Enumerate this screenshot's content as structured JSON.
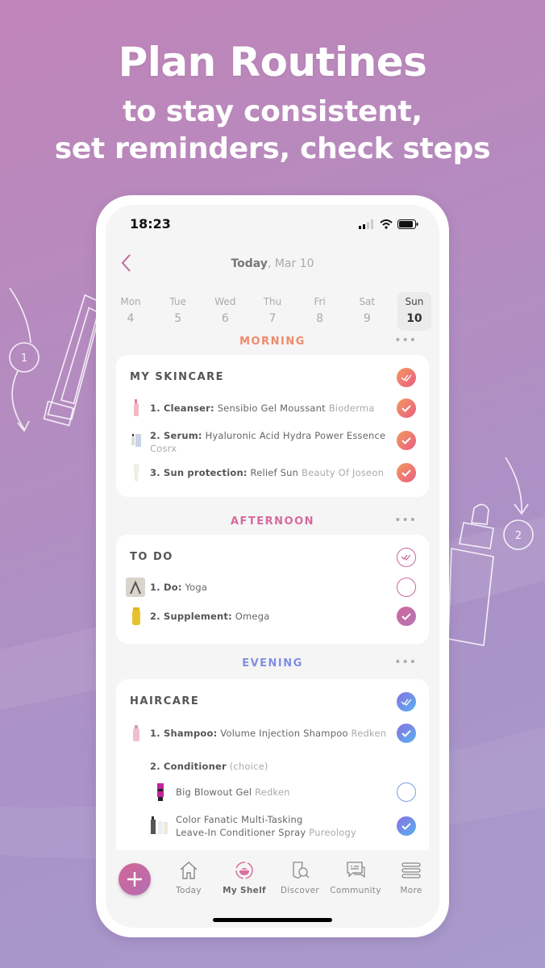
{
  "headline": {
    "title": "Plan Routines",
    "subtitle_line1": "to stay consistent,",
    "subtitle_line2": "set reminders, check steps"
  },
  "decorations": {
    "step1_label": "1",
    "step2_label": "2"
  },
  "status_bar": {
    "time": "18:23"
  },
  "nav": {
    "title_bold": "Today",
    "title_rest": ", Mar 10"
  },
  "week": [
    {
      "name": "Mon",
      "date": "4"
    },
    {
      "name": "Tue",
      "date": "5"
    },
    {
      "name": "Wed",
      "date": "6"
    },
    {
      "name": "Thu",
      "date": "7"
    },
    {
      "name": "Fri",
      "date": "8"
    },
    {
      "name": "Sat",
      "date": "9"
    },
    {
      "name": "Sun",
      "date": "10",
      "selected": true
    }
  ],
  "sections": {
    "morning": {
      "title": "MORNING",
      "color": "#ef8a6a",
      "menu": "•••",
      "routine": {
        "title": "MY SKINCARE",
        "all_done": true,
        "items": [
          {
            "label": "1. Cleanser:",
            "product": "Sensibio Gel Moussant",
            "brand": "Bioderma",
            "checked": true
          },
          {
            "label": "2. Serum:",
            "product": "Hyaluronic Acid Hydra Power Essence",
            "brand": "Cosrx",
            "checked": true
          },
          {
            "label": "3. Sun protection:",
            "product": "Relief Sun",
            "brand": "Beauty Of Joseon",
            "checked": true
          }
        ]
      }
    },
    "afternoon": {
      "title": "AFTERNOON",
      "color": "#d66a9e",
      "menu": "•••",
      "routine": {
        "title": "TO DO",
        "all_done": false,
        "items": [
          {
            "label": "1. Do:",
            "product": "Yoga",
            "brand": "",
            "checked": false
          },
          {
            "label": "2. Supplement:",
            "product": "Omega",
            "brand": "",
            "checked": true
          }
        ]
      }
    },
    "evening": {
      "title": "EVENING",
      "color": "#7f8fe0",
      "menu": "•••",
      "routine": {
        "title": "HAIRCARE",
        "all_done": true,
        "items": [
          {
            "label": "1. Shampoo:",
            "product": "Volume Injection Shampoo",
            "brand": "Redken",
            "checked": true
          }
        ],
        "choice_step": {
          "label": "2. Conditioner",
          "note": "(choice)",
          "options": [
            {
              "product": "Big Blowout Gel",
              "brand": "Redken",
              "checked": false
            },
            {
              "product_line1": "Color Fanatic Multi-Tasking",
              "product_line2": "Leave-In Conditioner Spray",
              "brand": "Pureology",
              "checked": true
            }
          ]
        }
      }
    }
  },
  "tabbar": {
    "add_icon": "plus-icon",
    "tabs": [
      {
        "label": "Today",
        "icon": "home-icon"
      },
      {
        "label": "My Shelf",
        "icon": "shelf-icon",
        "active": true
      },
      {
        "label": "Discover",
        "icon": "discover-icon"
      },
      {
        "label": "Community",
        "icon": "chat-icon"
      },
      {
        "label": "More",
        "icon": "menu-icon"
      }
    ]
  }
}
